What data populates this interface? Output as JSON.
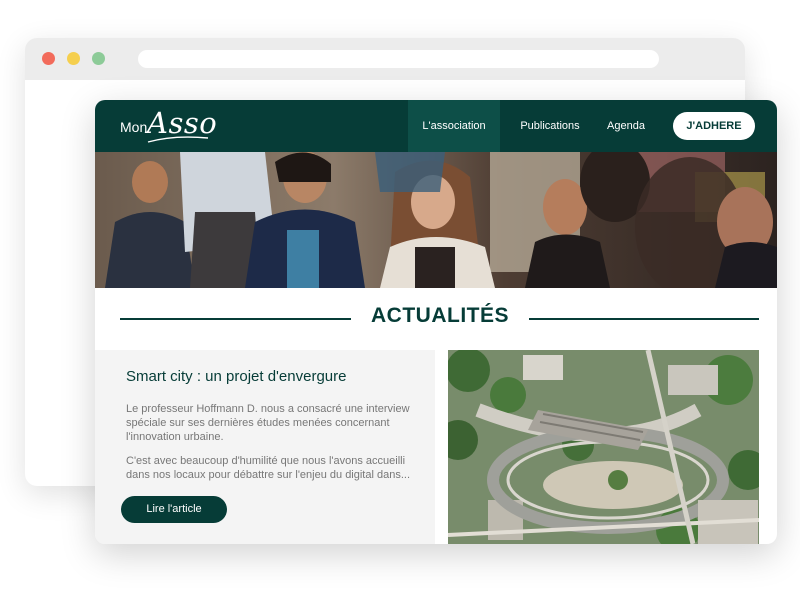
{
  "brand": {
    "prefix": "Mon",
    "name": "Asso"
  },
  "nav": {
    "items": [
      {
        "label": "L'association",
        "active": true
      },
      {
        "label": "Publications",
        "active": false
      },
      {
        "label": "Agenda",
        "active": false
      }
    ],
    "cta": "J'ADHERE"
  },
  "section": {
    "title": "ACTUALITÉS"
  },
  "article": {
    "title": "Smart city : un projet d'envergure",
    "paragraph1": "Le professeur Hoffmann D. nous a consacré une interview spéciale sur ses dernières études menées concernant l'innovation urbaine.",
    "paragraph2": "C'est avec beaucoup d'humilité que nous l'avons accueilli dans nos locaux pour débattre sur l'enjeu du digital dans...",
    "button": "Lire l'article"
  },
  "colors": {
    "primary": "#063c37",
    "nav_active": "#0d4f48",
    "article_bg": "#f4f4f4",
    "text_muted": "#777777"
  },
  "icons": {
    "window_controls": [
      "close-dot",
      "minimize-dot",
      "maximize-dot"
    ]
  }
}
